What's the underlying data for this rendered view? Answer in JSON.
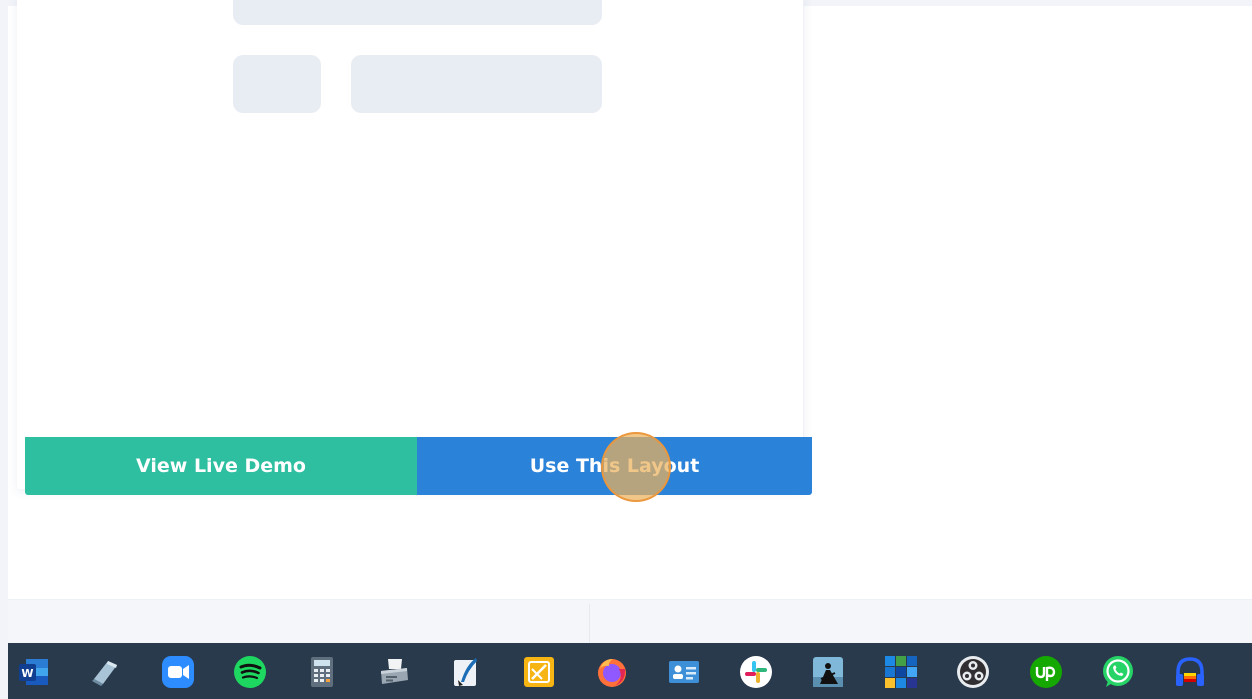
{
  "layout_card": {
    "view_demo_label": "View Live Demo",
    "use_layout_label": "Use This Layout"
  },
  "colors": {
    "demo_button": "#2ebea0",
    "use_button": "#2b82d9",
    "skeleton": "#e8edf4",
    "taskbar": "#293a4c",
    "cursor_highlight": "#ecb25c"
  },
  "taskbar": {
    "apps": [
      {
        "icon": "word-icon"
      },
      {
        "icon": "eraser-icon"
      },
      {
        "icon": "zoom-icon"
      },
      {
        "icon": "spotify-icon"
      },
      {
        "icon": "calculator-icon"
      },
      {
        "icon": "fax-icon"
      },
      {
        "icon": "quill-icon"
      },
      {
        "icon": "sketch-pad-icon"
      },
      {
        "icon": "firefox-icon"
      },
      {
        "icon": "contact-card-icon"
      },
      {
        "icon": "slack-icon"
      },
      {
        "icon": "kindle-icon"
      },
      {
        "icon": "tiles-icon"
      },
      {
        "icon": "obs-icon"
      },
      {
        "icon": "upwork-icon"
      },
      {
        "icon": "whatsapp-icon"
      },
      {
        "icon": "headphones-app-icon"
      }
    ]
  }
}
